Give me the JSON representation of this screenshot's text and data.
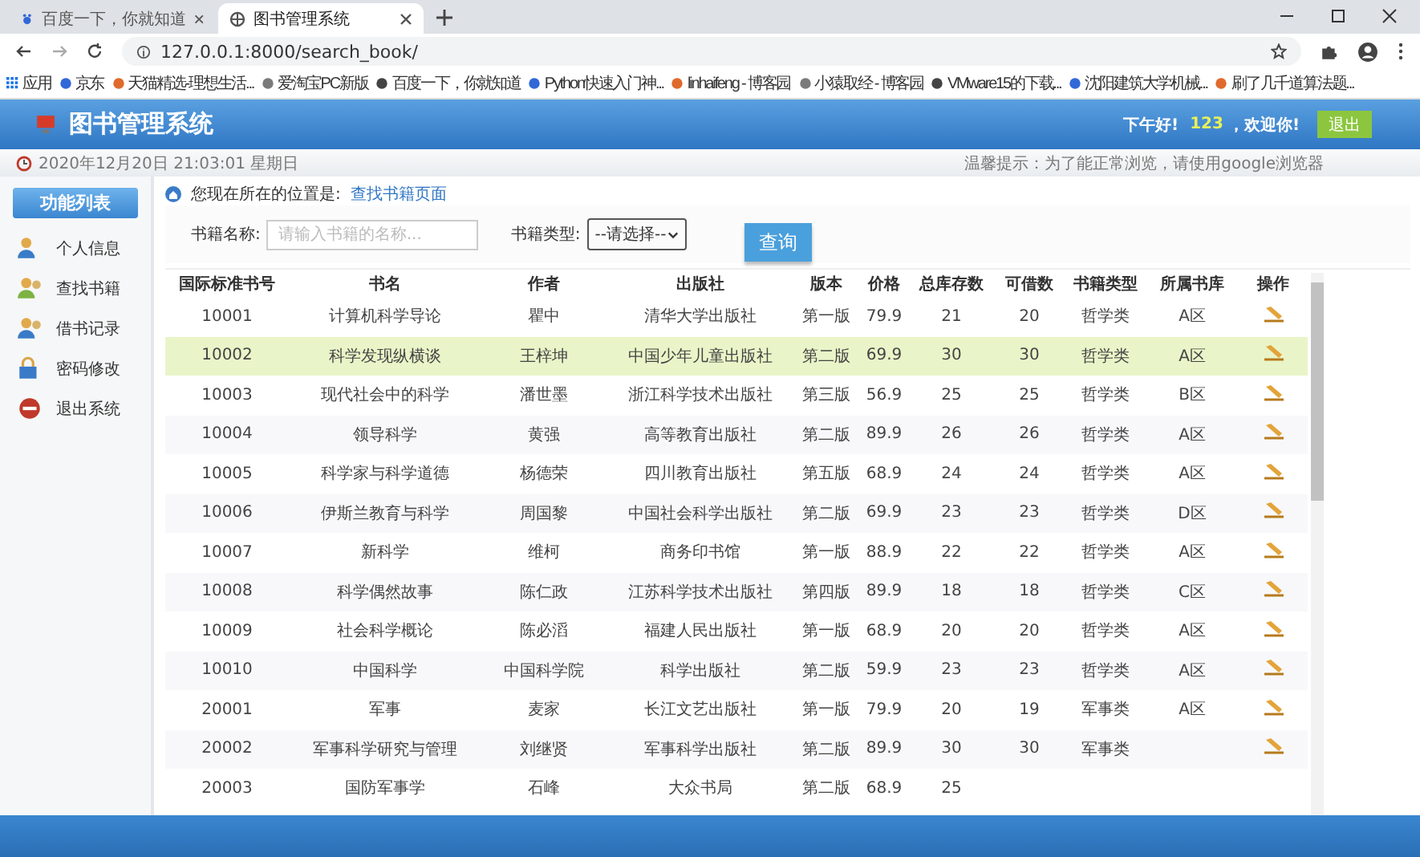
{
  "browser": {
    "tabs": [
      {
        "title": "百度一下，你就知道",
        "selected": false
      },
      {
        "title": "图书管理系统",
        "selected": true
      }
    ],
    "url": "127.0.0.1:8000/search_book/",
    "bookmarks": [
      "应用",
      "京东",
      "天猫精选-理想生活...",
      "爱淘宝PC新版",
      "百度一下，你就知道",
      "Python快速入门神...",
      "linhaifeng - 博客园",
      "小猿取经 - 博客园",
      "VMware15的下载...",
      "沈阳建筑大学机械...",
      "刷了几千道算法题..."
    ]
  },
  "header": {
    "title": "图书管理系统",
    "greeting": "下午好!",
    "username": "123",
    "welcome": "，欢迎你!",
    "logout": "退出"
  },
  "info_bar": {
    "datetime": "2020年12月20日 21:03:01 星期日",
    "tip": "温馨提示：为了能正常浏览，请使用google浏览器"
  },
  "sidebar": {
    "title": "功能列表",
    "items": [
      "个人信息",
      "查找书籍",
      "借书记录",
      "密码修改",
      "退出系统"
    ]
  },
  "breadcrumb": {
    "label": "您现在所在的位置是:",
    "page": "查找书籍页面"
  },
  "search": {
    "name_label": "书籍名称:",
    "name_placeholder": "请输入书籍的名称...",
    "type_label": "书籍类型:",
    "type_value": "--请选择--",
    "button": "查询"
  },
  "table": {
    "columns": [
      "国际标准书号",
      "书名",
      "作者",
      "出版社",
      "版本",
      "价格",
      "总库存数",
      "可借数",
      "书籍类型",
      "所属书库",
      "操作"
    ],
    "rows": [
      {
        "cells": [
          "10001",
          "计算机科学导论",
          "瞿中",
          "清华大学出版社",
          "第一版",
          "79.9",
          "21",
          "20",
          "哲学类",
          "A区"
        ],
        "edit_icon": true,
        "selected": false
      },
      {
        "cells": [
          "10002",
          "科学发现纵横谈",
          "王梓坤",
          "中国少年儿童出版社",
          "第二版",
          "69.9",
          "30",
          "30",
          "哲学类",
          "A区"
        ],
        "edit_icon": true,
        "selected": true
      },
      {
        "cells": [
          "10003",
          "现代社会中的科学",
          "潘世墨",
          "浙江科学技术出版社",
          "第三版",
          "56.9",
          "25",
          "25",
          "哲学类",
          "B区"
        ],
        "edit_icon": true,
        "selected": false
      },
      {
        "cells": [
          "10004",
          "领导科学",
          "黄强",
          "高等教育出版社",
          "第二版",
          "89.9",
          "26",
          "26",
          "哲学类",
          "A区"
        ],
        "edit_icon": true,
        "selected": false
      },
      {
        "cells": [
          "10005",
          "科学家与科学道德",
          "杨德荣",
          "四川教育出版社",
          "第五版",
          "68.9",
          "24",
          "24",
          "哲学类",
          "A区"
        ],
        "edit_icon": true,
        "selected": false
      },
      {
        "cells": [
          "10006",
          "伊斯兰教育与科学",
          "周国黎",
          "中国社会科学出版社",
          "第二版",
          "69.9",
          "23",
          "23",
          "哲学类",
          "D区"
        ],
        "edit_icon": true,
        "selected": false
      },
      {
        "cells": [
          "10007",
          "新科学",
          "维柯",
          "商务印书馆",
          "第一版",
          "88.9",
          "22",
          "22",
          "哲学类",
          "A区"
        ],
        "edit_icon": true,
        "selected": false
      },
      {
        "cells": [
          "10008",
          "科学偶然故事",
          "陈仁政",
          "江苏科学技术出版社",
          "第四版",
          "89.9",
          "18",
          "18",
          "哲学类",
          "C区"
        ],
        "edit_icon": true,
        "selected": false
      },
      {
        "cells": [
          "10009",
          "社会科学概论",
          "陈必滔",
          "福建人民出版社",
          "第一版",
          "68.9",
          "20",
          "20",
          "哲学类",
          "A区"
        ],
        "edit_icon": true,
        "selected": false
      },
      {
        "cells": [
          "10010",
          "中国科学",
          "中国科学院",
          "科学出版社",
          "第二版",
          "59.9",
          "23",
          "23",
          "哲学类",
          "A区"
        ],
        "edit_icon": true,
        "selected": false
      },
      {
        "cells": [
          "20001",
          "军事",
          "麦家",
          "长江文艺出版社",
          "第一版",
          "79.9",
          "20",
          "19",
          "军事类",
          "A区"
        ],
        "edit_icon": true,
        "selected": false
      },
      {
        "cells": [
          "20002",
          "军事科学研究与管理",
          "刘继贤",
          "军事科学出版社",
          "第二版",
          "89.9",
          "30",
          "30",
          "军事类"
        ],
        "edit_icon": true,
        "selected": false
      },
      {
        "cells": [
          "20003",
          "国防军事学",
          "石峰",
          "大众书局",
          "第二版",
          "68.9",
          "25"
        ],
        "edit_icon": false,
        "selected": false
      }
    ]
  }
}
